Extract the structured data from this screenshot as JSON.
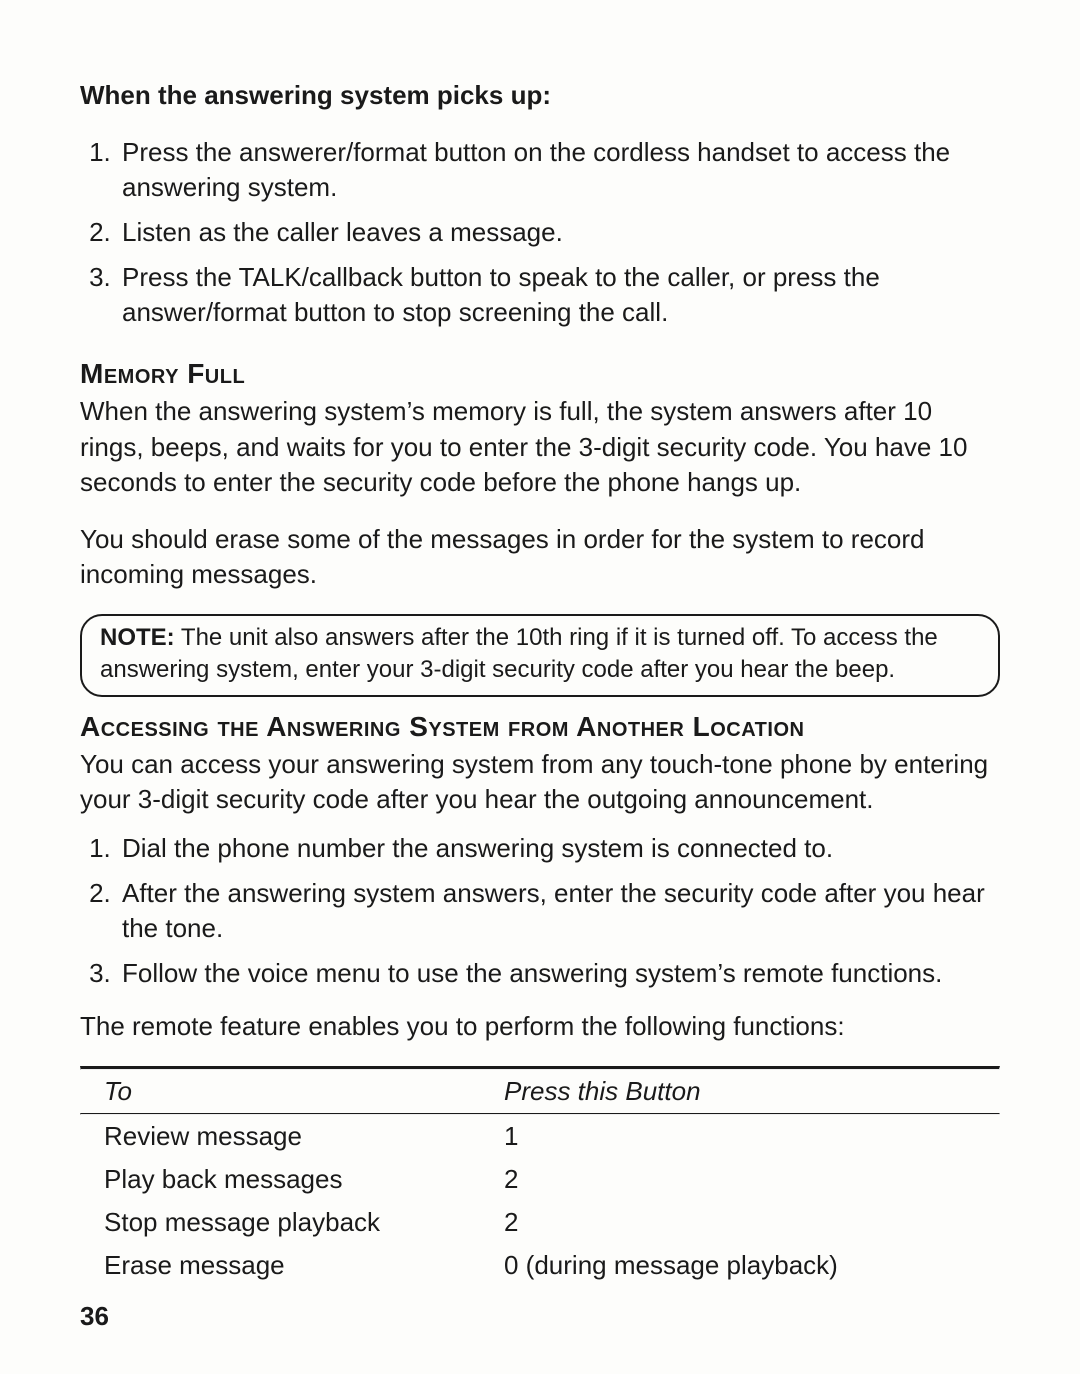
{
  "intro_heading": "When the answering system picks up:",
  "list1": {
    "i1": "Press the answerer/format button on the cordless handset to access the answering system.",
    "i2": "Listen as the caller leaves a message.",
    "i3": "Press the TALK/callback button to speak to the caller, or press the answer/format button to stop screening the call."
  },
  "memory_full": {
    "heading": "Memory Full",
    "p1": "When the answering system’s memory is full, the system answers after 10 rings, beeps, and waits for you to enter the 3-digit security code. You have 10 seconds to enter the security code before the phone hangs up.",
    "p2": "You should erase some of the messages in order for the system to record incoming messages."
  },
  "note": {
    "label": "NOTE:",
    "text": " The unit also answers after the 10th ring if it is turned off. To access the answering system, enter your 3-digit security code after you hear the beep."
  },
  "remote": {
    "heading": "Accessing the Answering System from Another Location",
    "p1": "You can access your answering system from any touch-tone phone by entering your 3-digit security code after you hear the outgoing announcement.",
    "list": {
      "i1": "Dial the phone number the answering system is connected to.",
      "i2": "After the answering system answers, enter the security code after you hear the tone.",
      "i3": "Follow the voice menu to use the answering system’s remote functions."
    },
    "p2": "The remote feature enables you to perform the following functions:"
  },
  "table": {
    "header": {
      "to": "To",
      "btn": "Press this Button"
    },
    "rows": [
      {
        "to": "Review message",
        "btn": "1"
      },
      {
        "to": "Play back messages",
        "btn": "2"
      },
      {
        "to": "Stop message playback",
        "btn": "2"
      },
      {
        "to": "Erase message",
        "btn": "0 (during message playback)"
      }
    ]
  },
  "page_number": "36"
}
